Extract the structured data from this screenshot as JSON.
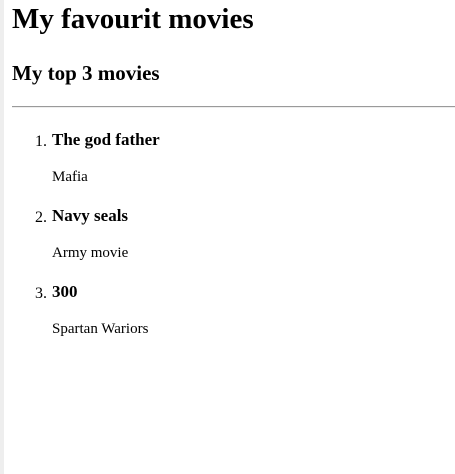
{
  "page": {
    "title": "My favourit movies",
    "subtitle": "My top 3 movies"
  },
  "movies": [
    {
      "number": "1.",
      "title": "The god father",
      "description": "Mafia"
    },
    {
      "number": "2.",
      "title": "Navy seals",
      "description": "Army movie"
    },
    {
      "number": "3.",
      "title": "300",
      "description": "Spartan Wariors"
    }
  ]
}
